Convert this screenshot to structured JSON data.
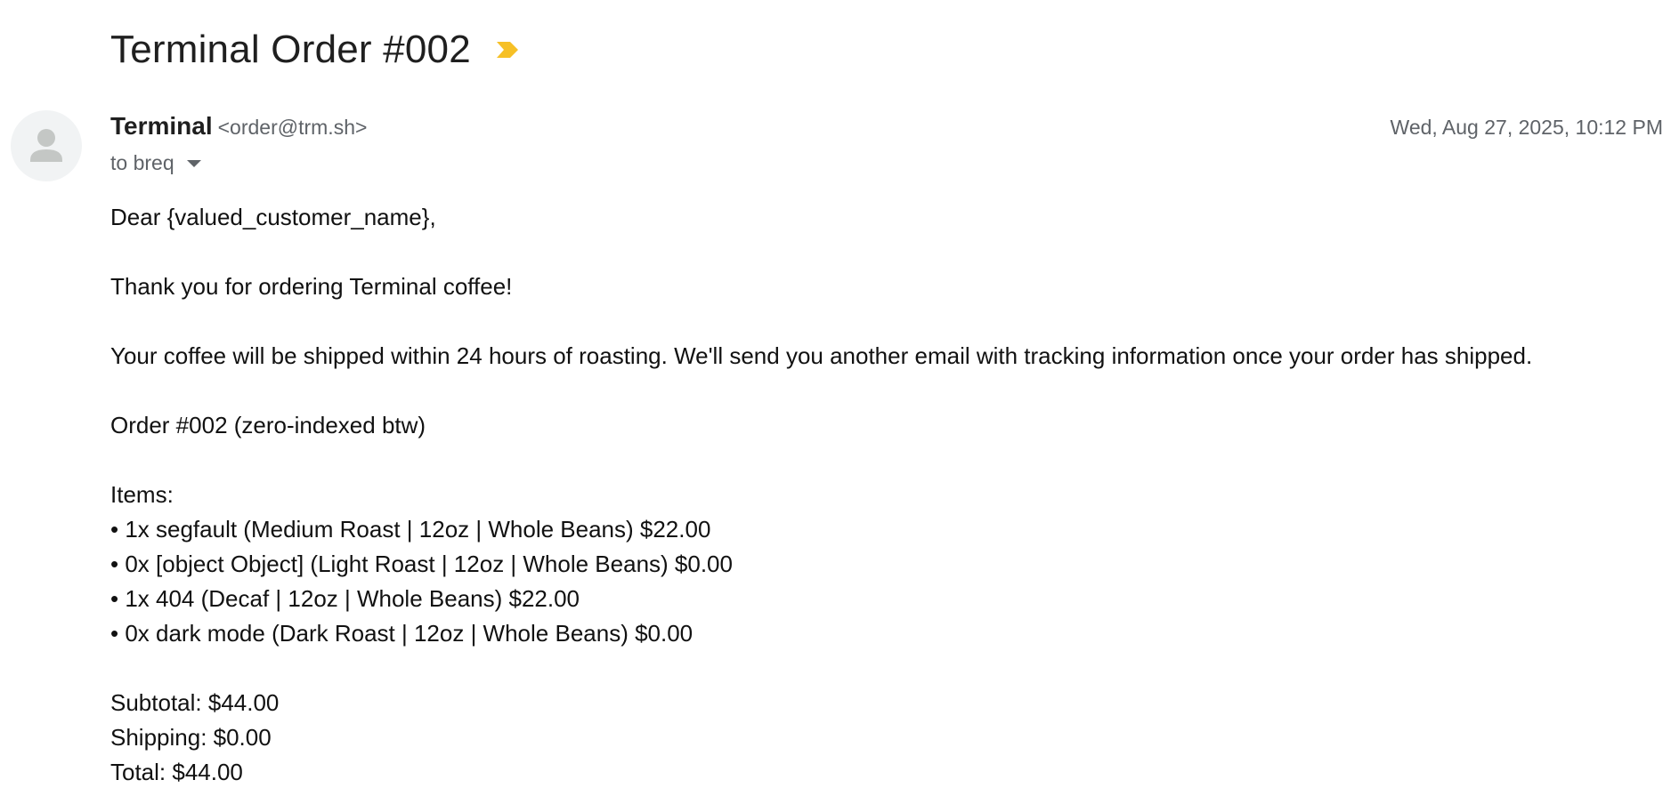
{
  "email": {
    "subject": "Terminal Order #002",
    "sender_name": "Terminal",
    "sender_email": "<order@trm.sh>",
    "date": "Wed, Aug 27, 2025, 10:12 PM",
    "recipient": "to breq",
    "icons": {
      "importance": "importance-marker-icon",
      "avatar": "person-icon",
      "recipient_details": "chevron-down-icon"
    },
    "colors": {
      "importance": "#f6c026",
      "avatar_bg": "#f1f3f4",
      "avatar_fg": "#c4c7c5"
    }
  },
  "body": {
    "greeting": "Dear {valued_customer_name},",
    "thanks": "Thank you for ordering Terminal coffee!",
    "shipping_note": "Your coffee will be shipped within 24 hours of roasting. We'll send you another email with tracking information once your order has shipped.",
    "order_line": "Order #002 (zero-indexed btw)",
    "items_header": "Items:",
    "items": [
      "• 1x segfault (Medium Roast | 12oz | Whole Beans) $22.00",
      "• 0x [object Object] (Light Roast | 12oz | Whole Beans) $0.00",
      "• 1x 404 (Decaf | 12oz | Whole Beans) $22.00",
      "• 0x dark mode (Dark Roast | 12oz | Whole Beans) $0.00"
    ],
    "subtotal": "Subtotal: $44.00",
    "shipping": "Shipping: $0.00",
    "total": "Total: $44.00"
  }
}
